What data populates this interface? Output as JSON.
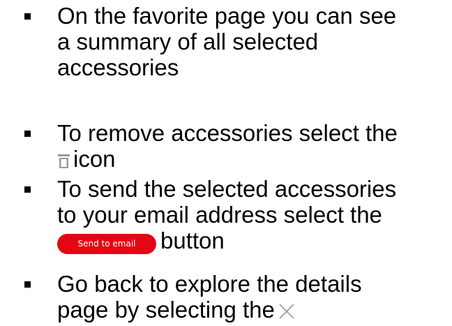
{
  "instructions": [
    {
      "lines": [
        "On the favorite page you can see",
        "a summary of all selected",
        "accessories"
      ]
    },
    {
      "lines": [
        "To remove accessories select the"
      ],
      "icon": "trash-icon",
      "after_icon": "icon"
    },
    {
      "lines": [
        "To send the selected accessories",
        "to your email address select the"
      ],
      "button_label": "Send to email",
      "after_button": "button"
    },
    {
      "lines": [
        "Go back to explore the details",
        "page by selecting the"
      ],
      "icon": "close-icon"
    }
  ],
  "colors": {
    "text": "#000000",
    "button_bg": "#e30613",
    "button_text": "#ffffff",
    "icon_gray": "#9a9a9a"
  }
}
